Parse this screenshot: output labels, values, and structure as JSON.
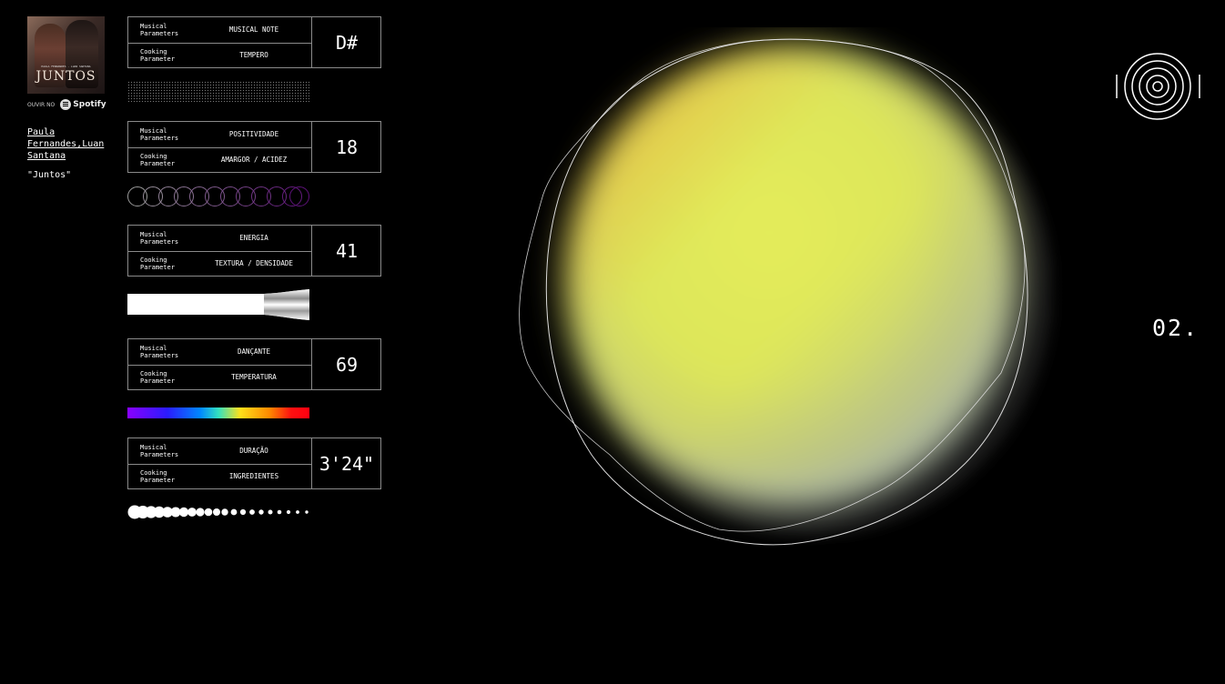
{
  "album": {
    "title": "JUNTOS",
    "artist_line": "PAULA FERNANDES · LUAN SANTANA"
  },
  "listen": {
    "label": "OUVIR NO",
    "service": "Spotify"
  },
  "artist": "Paula Fernandes,Luan Santana",
  "song": "\"Juntos\"",
  "params": [
    {
      "musical_label": "Musical Parameters",
      "musical": "MUSICAL NOTE",
      "cooking_label": "Cooking Parameter",
      "cooking": "TEMPERO",
      "value": "D#"
    },
    {
      "musical_label": "Musical Parameters",
      "musical": "POSITIVIDADE",
      "cooking_label": "Cooking Parameter",
      "cooking": "AMARGOR / ACIDEZ",
      "value": "18"
    },
    {
      "musical_label": "Musical Parameters",
      "musical": "ENERGIA",
      "cooking_label": "Cooking Parameter",
      "cooking": "TEXTURA / DENSIDADE",
      "value": "41"
    },
    {
      "musical_label": "Musical Parameters",
      "musical": "DANÇANTE",
      "cooking_label": "Cooking Parameter",
      "cooking": "TEMPERATURA",
      "value": "69"
    },
    {
      "musical_label": "Musical Parameters",
      "musical": "DURAÇÃO",
      "cooking_label": "Cooking Parameter",
      "cooking": "INGREDIENTES",
      "value": "3'24\""
    }
  ],
  "page_number": "02.",
  "colors": {
    "blob_yellow": "#e4ec5a",
    "blob_orange": "#e8b23e",
    "blob_gray": "#a9b4a4"
  }
}
